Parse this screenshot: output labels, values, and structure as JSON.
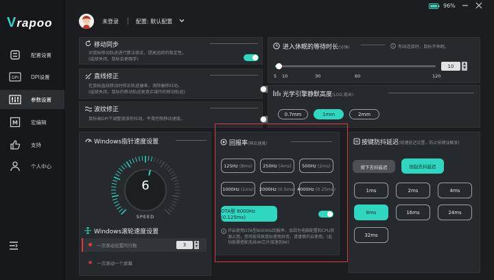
{
  "app": {
    "brand": "rapoo"
  },
  "titlebar": {
    "battery": "96%"
  },
  "user": {
    "status": "未登录",
    "config": "配置: 默认配置"
  },
  "sidebar": {
    "items": [
      {
        "label": "配置设置",
        "icon": "config-icon"
      },
      {
        "label": "DPI设置",
        "icon": "dpi-icon"
      },
      {
        "label": "参数设置",
        "icon": "params-icon",
        "active": true
      },
      {
        "label": "宏编辑",
        "icon": "macro-icon"
      },
      {
        "label": "支持",
        "icon": "thumb-up-icon"
      },
      {
        "label": "个人中心",
        "icon": "person-icon"
      }
    ]
  },
  "motion_sync": {
    "title": "移动同步",
    "desc1": "对鼠标移动轨迹进行算法修正，提高追踪的稳定性。",
    "desc2": "(选择关闭，鼠标会更跟手)",
    "enabled": true
  },
  "line_fix": {
    "title": "直线修正",
    "desc1": "在鼠标直线移动时修正轨迹偏差，消除偏移抖动。",
    "desc2": "(选择关闭，鼠标的移动轨迹更真实操作的移动轨迹)",
    "enabled": false
  },
  "ripple_fix": {
    "title": "波纹修正",
    "desc1": "鼠标高DPI下调整波浪形抖动，平滑控制移动速度。",
    "enabled": false
  },
  "sleep": {
    "title": "进入休眠的等待时长",
    "unit": "(分钟)",
    "note": "有线连接时，鼠标不休眠。",
    "value": "10",
    "ticks": [
      "5",
      "10",
      "30",
      "60",
      "120"
    ],
    "fraction": 0.02
  },
  "lod": {
    "title": "光学引擎静默高度",
    "unit": "(LOD,毫米)",
    "options": [
      "0.7mm",
      "1mm",
      "2mm"
    ],
    "selected": 1
  },
  "pointer_speed": {
    "title": "Windows指针速度设置",
    "value": "6",
    "label": "SPEED",
    "level": 0.55
  },
  "scroll_speed": {
    "title": "Windows滚轮速度设置",
    "row1": "一次滚动设置的行数",
    "row1_value": "3",
    "row2": "一次滚动一个屏幕"
  },
  "polling": {
    "title": "回报率",
    "unit": "(响应速度)",
    "rates": [
      {
        "hz": "125Hz",
        "ms": "(8ms)"
      },
      {
        "hz": "250Hz",
        "ms": "(4ms)"
      },
      {
        "hz": "500Hz",
        "ms": "(2ms)"
      },
      {
        "hz": "1000Hz",
        "ms": "(1ms)"
      },
      {
        "hz": "2000Hz",
        "ms": "(0.5ms)"
      },
      {
        "hz": "4000Hz",
        "ms": "(0.25ms)"
      }
    ],
    "ota_label": "OTA型 8000Hz (0.125ms)",
    "ota_enabled": true,
    "desc": "开启使用OTA型8000Hz回报率，会因为电脑配置和CPU资源占用，而可能导致鼠标使用异常，请谨慎开启使用。(此功能需搭配无线4K芯片接速到8K)"
  },
  "debounce": {
    "title": "按键防抖延迟",
    "subtitle": "(按键延迟设置，防止按键误触发)",
    "tabs": [
      "按下去抖延迟",
      "抬起去抖延迟"
    ],
    "active_tab": 1,
    "options": [
      "1ms",
      "2ms",
      "4ms",
      "8ms",
      "16ms",
      "24ms",
      "32ms"
    ],
    "selected": 3
  },
  "colors": {
    "accent": "#2fd6c0",
    "highlight": "#e0393e"
  }
}
